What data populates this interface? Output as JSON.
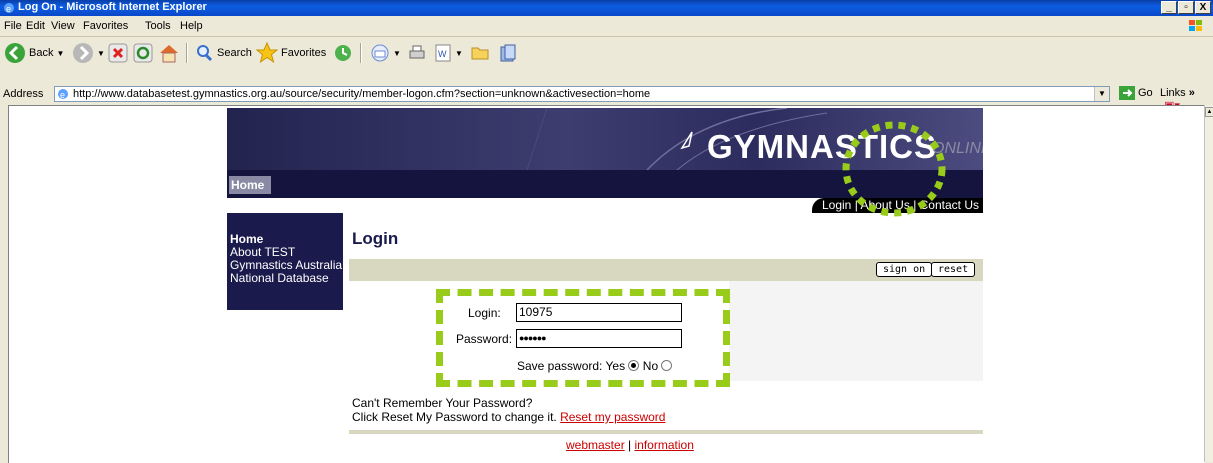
{
  "window": {
    "title": "Log On - Microsoft Internet Explorer",
    "controls": [
      "_",
      "▫",
      "X"
    ]
  },
  "menubar": {
    "items": [
      "File",
      "Edit",
      "View",
      "Favorites",
      "Tools",
      "Help"
    ]
  },
  "toolbar": {
    "back_label": "Back",
    "search_label": "Search",
    "favorites_label": "Favorites"
  },
  "address": {
    "label": "Address",
    "url": "http://www.databasetest.gymnastics.org.au/source/security/member-logon.cfm?section=unknown&activesection=home",
    "go_label": "Go",
    "links_label": "Links"
  },
  "banner": {
    "logo_text": "GYMNASTICS",
    "logo_suffix": "ONLINE",
    "home_label": "Home",
    "top_links": [
      "Login",
      "About Us",
      "Contact Us"
    ]
  },
  "leftnav": {
    "items": [
      "Home",
      "About TEST",
      "Gymnastics Australia",
      "National Database"
    ]
  },
  "login": {
    "title": "Login",
    "sign_on_label": "sign on",
    "reset_label": "reset",
    "login_label": "Login:",
    "login_value": "10975",
    "password_label": "Password:",
    "password_value": "●●●●●●",
    "save_password_label": "Save password:",
    "yes_label": "Yes",
    "no_label": "No",
    "forgot_line1": "Can't Remember Your Password?",
    "forgot_line2": "Click Reset My Password to change it.",
    "reset_link": "Reset my password"
  },
  "footer": {
    "webmaster": "webmaster",
    "separator": "|",
    "information": "information"
  },
  "colors": {
    "navy": "#1a1a4c",
    "highlight_green": "#99cc1a",
    "link_red": "#cc0000"
  }
}
